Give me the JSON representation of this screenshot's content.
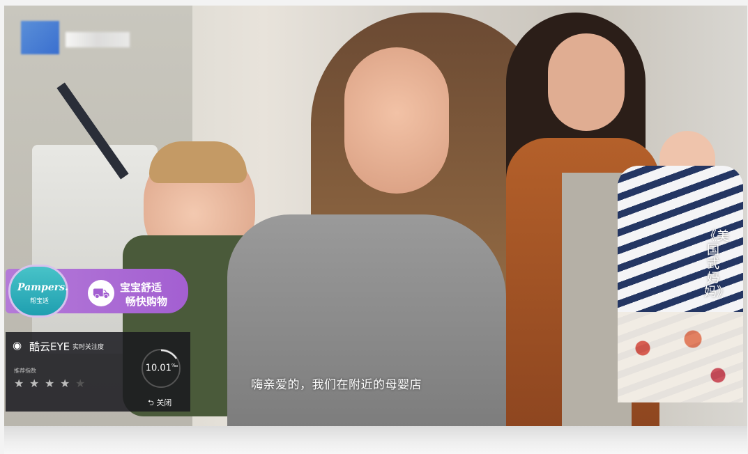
{
  "subtitle": "嗨亲爱的，我们在附近的母婴店",
  "show_title": "《美国式妈妈》",
  "ad": {
    "brand_name": "Pampers.",
    "brand_sub": "帮宝适",
    "line1": "宝宝舒适",
    "line2": "畅快购物"
  },
  "panel": {
    "app_name": "酷云EYE",
    "app_sub": "实时关注度",
    "rating_label": "推荐指数",
    "score": "10.01",
    "score_unit": "‰",
    "stars_filled": 4,
    "stars_total": 5,
    "close_label": "关闭"
  },
  "colors": {
    "ad_purple": "#a35fd1",
    "brand_teal": "#1f9fb0"
  }
}
